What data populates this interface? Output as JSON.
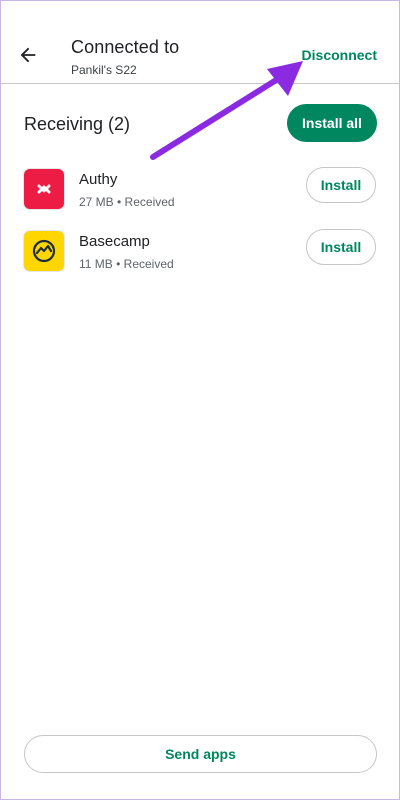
{
  "header": {
    "title": "Connected to",
    "subtitle": "Pankil's S22",
    "disconnect_label": "Disconnect"
  },
  "receiving": {
    "title": "Receiving (2)",
    "install_all_label": "Install all",
    "apps": [
      {
        "name": "Authy",
        "meta": "27 MB • Received",
        "install_label": "Install",
        "icon": "authy-icon"
      },
      {
        "name": "Basecamp",
        "meta": "11 MB • Received",
        "install_label": "Install",
        "icon": "basecamp-icon"
      }
    ]
  },
  "footer": {
    "send_apps_label": "Send apps"
  },
  "colors": {
    "accent": "#01875f",
    "annotation_arrow": "#8a2be2",
    "authy_red": "#ec1c44",
    "basecamp_yellow": "#ffd600"
  },
  "icons": {
    "back": "arrow-left-icon"
  }
}
